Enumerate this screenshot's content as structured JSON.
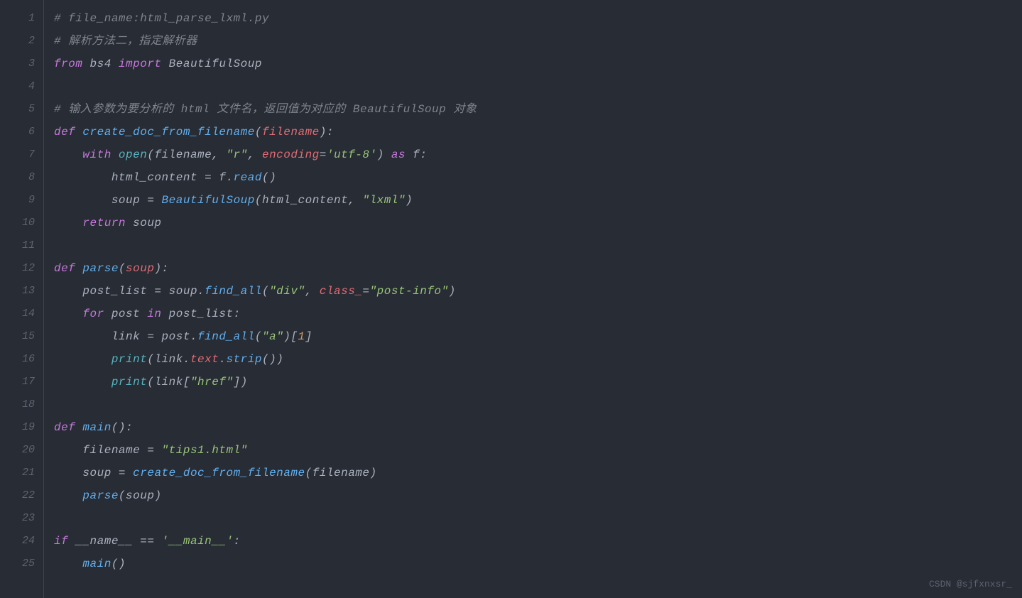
{
  "watermark": "CSDN @sjfxnxsr_",
  "lines": [
    {
      "num": "1",
      "tokens": [
        {
          "cls": "tok-comment",
          "t": "# file_name:html_parse_lxml.py"
        }
      ]
    },
    {
      "num": "2",
      "tokens": [
        {
          "cls": "tok-comment",
          "t": "# 解析方法二，指定解析器"
        }
      ]
    },
    {
      "num": "3",
      "tokens": [
        {
          "cls": "tok-keyword",
          "t": "from"
        },
        {
          "cls": "tok-plain",
          "t": " bs4 "
        },
        {
          "cls": "tok-keyword",
          "t": "import"
        },
        {
          "cls": "tok-plain",
          "t": " BeautifulSoup"
        }
      ]
    },
    {
      "num": "4",
      "tokens": [
        {
          "cls": "tok-plain",
          "t": ""
        }
      ]
    },
    {
      "num": "5",
      "tokens": [
        {
          "cls": "tok-comment",
          "t": "# 输入参数为要分析的 html 文件名，返回值为对应的 BeautifulSoup 对象"
        }
      ]
    },
    {
      "num": "6",
      "tokens": [
        {
          "cls": "tok-keyword",
          "t": "def"
        },
        {
          "cls": "tok-plain",
          "t": " "
        },
        {
          "cls": "tok-funcdef",
          "t": "create_doc_from_filename"
        },
        {
          "cls": "tok-punct",
          "t": "("
        },
        {
          "cls": "tok-param",
          "t": "filename"
        },
        {
          "cls": "tok-punct",
          "t": "):"
        }
      ]
    },
    {
      "num": "7",
      "tokens": [
        {
          "cls": "tok-plain",
          "t": "    "
        },
        {
          "cls": "tok-keyword",
          "t": "with"
        },
        {
          "cls": "tok-plain",
          "t": " "
        },
        {
          "cls": "tok-builtin",
          "t": "open"
        },
        {
          "cls": "tok-punct",
          "t": "("
        },
        {
          "cls": "tok-plain",
          "t": "filename"
        },
        {
          "cls": "tok-punct",
          "t": ", "
        },
        {
          "cls": "tok-string",
          "t": "\"r\""
        },
        {
          "cls": "tok-punct",
          "t": ", "
        },
        {
          "cls": "tok-param",
          "t": "encoding"
        },
        {
          "cls": "tok-op",
          "t": "="
        },
        {
          "cls": "tok-string",
          "t": "'utf-8'"
        },
        {
          "cls": "tok-punct",
          "t": ") "
        },
        {
          "cls": "tok-keyword",
          "t": "as"
        },
        {
          "cls": "tok-plain",
          "t": " f"
        },
        {
          "cls": "tok-punct",
          "t": ":"
        }
      ]
    },
    {
      "num": "8",
      "tokens": [
        {
          "cls": "tok-plain",
          "t": "        html_content "
        },
        {
          "cls": "tok-op",
          "t": "="
        },
        {
          "cls": "tok-plain",
          "t": " f"
        },
        {
          "cls": "tok-punct",
          "t": "."
        },
        {
          "cls": "tok-funccall",
          "t": "read"
        },
        {
          "cls": "tok-punct",
          "t": "()"
        }
      ]
    },
    {
      "num": "9",
      "tokens": [
        {
          "cls": "tok-plain",
          "t": "        soup "
        },
        {
          "cls": "tok-op",
          "t": "="
        },
        {
          "cls": "tok-plain",
          "t": " "
        },
        {
          "cls": "tok-funccall",
          "t": "BeautifulSoup"
        },
        {
          "cls": "tok-punct",
          "t": "("
        },
        {
          "cls": "tok-plain",
          "t": "html_content"
        },
        {
          "cls": "tok-punct",
          "t": ", "
        },
        {
          "cls": "tok-string",
          "t": "\"lxml\""
        },
        {
          "cls": "tok-punct",
          "t": ")"
        }
      ]
    },
    {
      "num": "10",
      "tokens": [
        {
          "cls": "tok-plain",
          "t": "    "
        },
        {
          "cls": "tok-keyword",
          "t": "return"
        },
        {
          "cls": "tok-plain",
          "t": " soup"
        }
      ]
    },
    {
      "num": "11",
      "tokens": [
        {
          "cls": "tok-plain",
          "t": ""
        }
      ]
    },
    {
      "num": "12",
      "tokens": [
        {
          "cls": "tok-keyword",
          "t": "def"
        },
        {
          "cls": "tok-plain",
          "t": " "
        },
        {
          "cls": "tok-funcdef",
          "t": "parse"
        },
        {
          "cls": "tok-punct",
          "t": "("
        },
        {
          "cls": "tok-param",
          "t": "soup"
        },
        {
          "cls": "tok-punct",
          "t": "):"
        }
      ]
    },
    {
      "num": "13",
      "tokens": [
        {
          "cls": "tok-plain",
          "t": "    post_list "
        },
        {
          "cls": "tok-op",
          "t": "="
        },
        {
          "cls": "tok-plain",
          "t": " soup"
        },
        {
          "cls": "tok-punct",
          "t": "."
        },
        {
          "cls": "tok-funccall",
          "t": "find_all"
        },
        {
          "cls": "tok-punct",
          "t": "("
        },
        {
          "cls": "tok-string",
          "t": "\"div\""
        },
        {
          "cls": "tok-punct",
          "t": ", "
        },
        {
          "cls": "tok-param",
          "t": "class_"
        },
        {
          "cls": "tok-op",
          "t": "="
        },
        {
          "cls": "tok-string",
          "t": "\"post-info\""
        },
        {
          "cls": "tok-punct",
          "t": ")"
        }
      ]
    },
    {
      "num": "14",
      "tokens": [
        {
          "cls": "tok-plain",
          "t": "    "
        },
        {
          "cls": "tok-keyword",
          "t": "for"
        },
        {
          "cls": "tok-plain",
          "t": " post "
        },
        {
          "cls": "tok-keyword",
          "t": "in"
        },
        {
          "cls": "tok-plain",
          "t": " post_list"
        },
        {
          "cls": "tok-punct",
          "t": ":"
        }
      ]
    },
    {
      "num": "15",
      "tokens": [
        {
          "cls": "tok-plain",
          "t": "        link "
        },
        {
          "cls": "tok-op",
          "t": "="
        },
        {
          "cls": "tok-plain",
          "t": " post"
        },
        {
          "cls": "tok-punct",
          "t": "."
        },
        {
          "cls": "tok-funccall",
          "t": "find_all"
        },
        {
          "cls": "tok-punct",
          "t": "("
        },
        {
          "cls": "tok-string",
          "t": "\"a\""
        },
        {
          "cls": "tok-punct",
          "t": ")["
        },
        {
          "cls": "tok-num",
          "t": "1"
        },
        {
          "cls": "tok-punct",
          "t": "]"
        }
      ]
    },
    {
      "num": "16",
      "tokens": [
        {
          "cls": "tok-plain",
          "t": "        "
        },
        {
          "cls": "tok-builtin",
          "t": "print"
        },
        {
          "cls": "tok-punct",
          "t": "("
        },
        {
          "cls": "tok-plain",
          "t": "link"
        },
        {
          "cls": "tok-punct",
          "t": "."
        },
        {
          "cls": "tok-attr",
          "t": "text"
        },
        {
          "cls": "tok-punct",
          "t": "."
        },
        {
          "cls": "tok-funccall",
          "t": "strip"
        },
        {
          "cls": "tok-punct",
          "t": "())"
        }
      ]
    },
    {
      "num": "17",
      "tokens": [
        {
          "cls": "tok-plain",
          "t": "        "
        },
        {
          "cls": "tok-builtin",
          "t": "print"
        },
        {
          "cls": "tok-punct",
          "t": "("
        },
        {
          "cls": "tok-plain",
          "t": "link"
        },
        {
          "cls": "tok-punct",
          "t": "["
        },
        {
          "cls": "tok-string",
          "t": "\"href\""
        },
        {
          "cls": "tok-punct",
          "t": "])"
        }
      ]
    },
    {
      "num": "18",
      "tokens": [
        {
          "cls": "tok-plain",
          "t": ""
        }
      ]
    },
    {
      "num": "19",
      "tokens": [
        {
          "cls": "tok-keyword",
          "t": "def"
        },
        {
          "cls": "tok-plain",
          "t": " "
        },
        {
          "cls": "tok-funcdef",
          "t": "main"
        },
        {
          "cls": "tok-punct",
          "t": "():"
        }
      ]
    },
    {
      "num": "20",
      "tokens": [
        {
          "cls": "tok-plain",
          "t": "    filename "
        },
        {
          "cls": "tok-op",
          "t": "="
        },
        {
          "cls": "tok-plain",
          "t": " "
        },
        {
          "cls": "tok-string",
          "t": "\"tips1.html\""
        }
      ]
    },
    {
      "num": "21",
      "tokens": [
        {
          "cls": "tok-plain",
          "t": "    soup "
        },
        {
          "cls": "tok-op",
          "t": "="
        },
        {
          "cls": "tok-plain",
          "t": " "
        },
        {
          "cls": "tok-funccall",
          "t": "create_doc_from_filename"
        },
        {
          "cls": "tok-punct",
          "t": "("
        },
        {
          "cls": "tok-plain",
          "t": "filename"
        },
        {
          "cls": "tok-punct",
          "t": ")"
        }
      ]
    },
    {
      "num": "22",
      "tokens": [
        {
          "cls": "tok-plain",
          "t": "    "
        },
        {
          "cls": "tok-funccall",
          "t": "parse"
        },
        {
          "cls": "tok-punct",
          "t": "("
        },
        {
          "cls": "tok-plain",
          "t": "soup"
        },
        {
          "cls": "tok-punct",
          "t": ")"
        }
      ]
    },
    {
      "num": "23",
      "tokens": [
        {
          "cls": "tok-plain",
          "t": ""
        }
      ]
    },
    {
      "num": "24",
      "tokens": [
        {
          "cls": "tok-keyword",
          "t": "if"
        },
        {
          "cls": "tok-plain",
          "t": " __name__ "
        },
        {
          "cls": "tok-op",
          "t": "=="
        },
        {
          "cls": "tok-plain",
          "t": " "
        },
        {
          "cls": "tok-string",
          "t": "'__main__'"
        },
        {
          "cls": "tok-punct",
          "t": ":"
        }
      ]
    },
    {
      "num": "25",
      "tokens": [
        {
          "cls": "tok-plain",
          "t": "    "
        },
        {
          "cls": "tok-funccall",
          "t": "main"
        },
        {
          "cls": "tok-punct",
          "t": "()"
        }
      ]
    }
  ]
}
